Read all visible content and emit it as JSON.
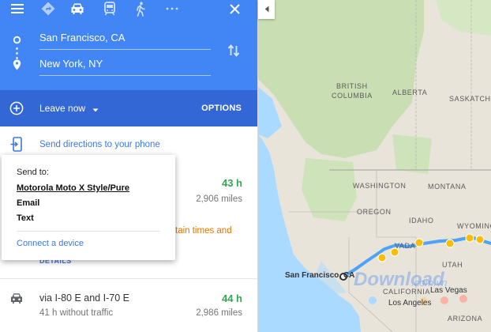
{
  "directions": {
    "origin": "San Francisco, CA",
    "destination": "New York, NY",
    "leave_label": "Leave now",
    "options_label": "OPTIONS",
    "send_label": "Send directions to your phone"
  },
  "routes": [
    {
      "time": "43 h",
      "miles": "2,906 miles",
      "warning": "tain times and",
      "details_label": "DETAILS"
    },
    {
      "via": "via I-80 E and I-70 E",
      "time": "44 h",
      "sub": "41 h without traffic",
      "miles": "2,986 miles"
    }
  ],
  "popup": {
    "title": "Send to:",
    "items": [
      "Motorola Moto X Style/Pure",
      "Email",
      "Text"
    ],
    "connect_label": "Connect a device"
  },
  "map": {
    "labels": {
      "british_columbia": "BRITISH\nCOLUMBIA",
      "alberta": "ALBERTA",
      "saskatchewan": "SASKATCHE",
      "washington": "WASHINGTON",
      "montana": "MONTANA",
      "oregon": "OREGON",
      "idaho": "IDAHO",
      "wyoming": "WYOMING",
      "nevada": "VADA",
      "utah": "UTAH",
      "california": "CALIFORNIA",
      "arizona": "ARIZONA"
    },
    "cities": {
      "san_francisco": "San Francisco, CA",
      "los_angeles": "Los Angeles",
      "las_vegas": "Las Vegas"
    },
    "watermark": "Download",
    "watermark_suffix": ".com.vn"
  },
  "colors": {
    "header_blue": "#4285f4",
    "leave_bar_blue": "#3367d6",
    "link_blue": "#3b78e7",
    "time_green": "#34a853",
    "warning_orange": "#e37400",
    "route_line": "#4da3f7",
    "land": "#e8e4da",
    "forest": "#c9dfb3",
    "water": "#aadaff"
  },
  "icons": [
    "menu-icon",
    "directions-icon",
    "car-icon",
    "transit-icon",
    "walk-icon",
    "more-icon",
    "close-icon",
    "origin-dot-icon",
    "destination-pin-icon",
    "swap-icon",
    "add-icon",
    "dropdown-icon",
    "send-to-phone-icon",
    "car-route-icon",
    "collapse-arrow-icon"
  ]
}
